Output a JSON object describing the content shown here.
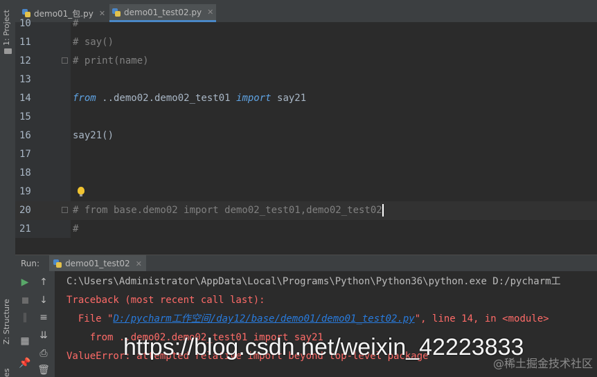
{
  "sidebar": {
    "project_label": "1: Project",
    "structure_label": "Z: Structure",
    "extra_label": "es"
  },
  "tabs": [
    {
      "label": "demo01_包.py",
      "active": false
    },
    {
      "label": "demo01_test02.py",
      "active": true
    }
  ],
  "editor": {
    "lines": [
      {
        "num": "10",
        "text": "#"
      },
      {
        "num": "11",
        "text": "# say()"
      },
      {
        "num": "12",
        "text": "# print(name)"
      },
      {
        "num": "13",
        "text": ""
      },
      {
        "num": "14",
        "kw1": "from",
        "mid": " ..demo02.demo02_test01 ",
        "kw2": "import",
        "tail": " say21"
      },
      {
        "num": "15",
        "text": ""
      },
      {
        "num": "16",
        "text": "say21()"
      },
      {
        "num": "17",
        "text": ""
      },
      {
        "num": "18",
        "text": ""
      },
      {
        "num": "19",
        "text": ""
      },
      {
        "num": "20",
        "text": "# from base.demo02 import demo02_test01,demo02_test02"
      },
      {
        "num": "21",
        "text": "#"
      }
    ]
  },
  "run": {
    "label": "Run:",
    "tab_label": "demo01_test02"
  },
  "console": {
    "line1": "C:\\Users\\Administrator\\AppData\\Local\\Programs\\Python\\Python36\\python.exe D:/pycharm工",
    "line2": "Traceback (most recent call last):",
    "line3_prefix": "  File \"",
    "line3_link": "D:/pycharm工作空间/day12/base/demo01/demo01_test02.py",
    "line3_suffix": "\", line 14, in <module>",
    "line4": "    from ..demo02.demo02_test01 import say21",
    "line5": "ValueError: attempted relative import beyond top-level package"
  },
  "watermark": {
    "url": "https://blog.csdn.net/weixin_42223833",
    "cn": "@稀土掘金技术社区"
  },
  "colors": {
    "keyword": "#5fa3e3",
    "comment": "#808080",
    "error": "#ff6b68",
    "link": "#287bde"
  }
}
